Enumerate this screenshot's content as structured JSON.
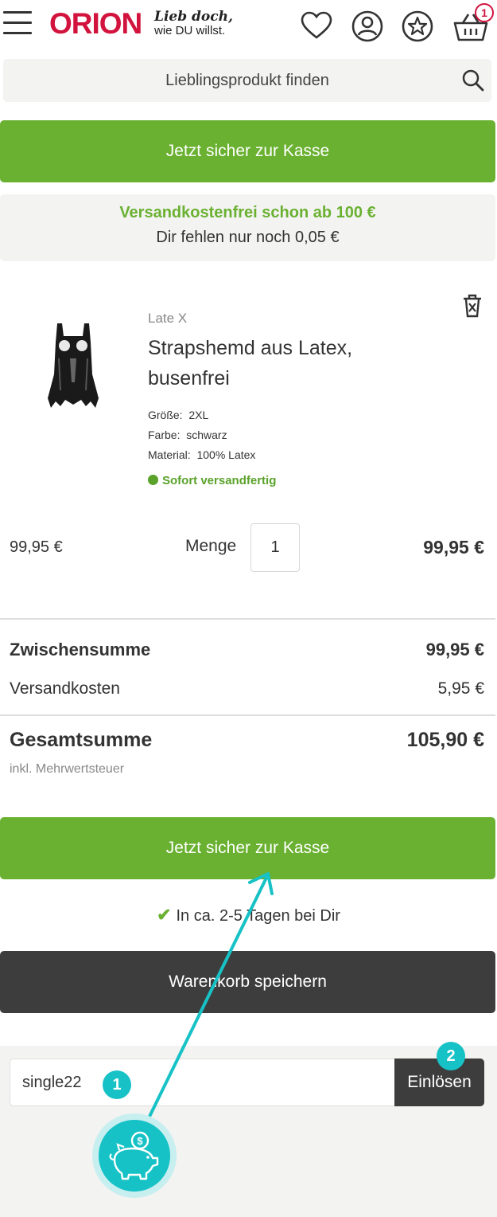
{
  "header": {
    "logo": "ORION",
    "tagline_line1": "Lieb doch,",
    "tagline_line2": "wie DU willst.",
    "cart_count": "1",
    "icons": [
      "menu-icon",
      "heart-icon",
      "account-icon",
      "star-icon",
      "basket-icon"
    ]
  },
  "search": {
    "placeholder": "Lieblingsprodukt finden"
  },
  "checkout_top": {
    "label": "Jetzt sicher zur Kasse"
  },
  "shipping_notice": {
    "headline": "Versandkostenfrei schon ab 100 €",
    "missing": "Dir fehlen nur noch 0,05 €"
  },
  "item": {
    "brand": "Late X",
    "name": "Strapshemd aus Latex, busenfrei",
    "size_label": "Größe:",
    "size": "2XL",
    "color_label": "Farbe:",
    "color": "schwarz",
    "material_label": "Material:",
    "material": "100% Latex",
    "availability": "Sofort versandfertig",
    "unit_price": "99,95 €",
    "quantity_label": "Menge",
    "quantity": "1",
    "line_total": "99,95 €"
  },
  "summary": {
    "subtotal_label": "Zwischensumme",
    "subtotal": "99,95 €",
    "shipping_label": "Versandkosten",
    "shipping": "5,95 €",
    "total_label": "Gesamtsumme",
    "total": "105,90 €",
    "vat_note": "inkl. Mehrwertsteuer"
  },
  "checkout_bottom": {
    "label": "Jetzt sicher zur Kasse"
  },
  "delivery": {
    "text": "In ca. 2-5 Tagen bei Dir"
  },
  "save_cart": {
    "label": "Warenkorb speichern"
  },
  "coupon": {
    "value": "single22",
    "redeem_label": "Einlösen"
  },
  "annotations": {
    "step1": "1",
    "step2": "2"
  },
  "colors": {
    "brand_red": "#d2133d",
    "green": "#6ab131",
    "dark": "#3d3d3d",
    "teal": "#17c2c6"
  }
}
